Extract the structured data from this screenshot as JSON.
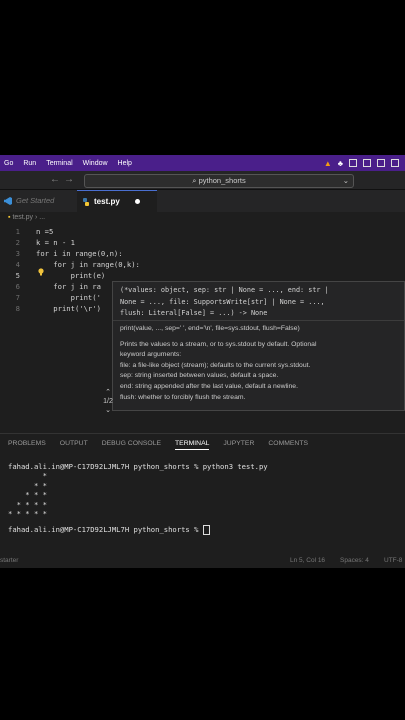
{
  "menubar": {
    "items": [
      "Go",
      "Run",
      "Terminal",
      "Window",
      "Help"
    ]
  },
  "search": {
    "text": "python_shorts"
  },
  "tabs": {
    "get_started": "Get Started",
    "active": "test.py"
  },
  "breadcrumb": {
    "file": "test.py",
    "more": "..."
  },
  "editor": {
    "line_numbers": [
      "1",
      "2",
      "3",
      "4",
      "5",
      "6",
      "7",
      "8"
    ],
    "lines": [
      "n =5",
      "k = n - 1",
      "for i in range(0,n):",
      "    for j in range(0,k):",
      "        print(e)",
      "    for j in ra",
      "        print('",
      "    print('\\r')"
    ]
  },
  "hover": {
    "signature": [
      "(*values: object, sep: str | None = ..., end: str |",
      "None = ..., file: SupportsWrite[str] | None = ...,",
      "flush: Literal[False] = ...) -> None"
    ],
    "usage": "print(value, ..., sep=' ', end='\\n', file=sys.stdout, flush=False)",
    "lines": [
      "Prints the values to a stream, or to sys.stdout by default. Optional",
      "keyword arguments:",
      "file: a file-like object (stream); defaults to the current sys.stdout.",
      "sep: string inserted between values, default a space.",
      "end: string appended after the last value, default a newline.",
      "flush: whether to forcibly flush the stream."
    ],
    "pager": "1/2"
  },
  "panel": {
    "tabs": [
      "PROBLEMS",
      "OUTPUT",
      "DEBUG CONSOLE",
      "TERMINAL",
      "JUPYTER",
      "COMMENTS"
    ],
    "active": "TERMINAL"
  },
  "terminal": {
    "lines": [
      "fahad.ali.in@MP-C17D92LJML7H python_shorts % python3 test.py",
      "        *",
      "      * *",
      "    * * *",
      "  * * * *",
      "* * * * *",
      "fahad.ali.in@MP-C17D92LJML7H python_shorts % "
    ]
  },
  "status": {
    "left": "starter",
    "position": "Ln 5, Col 16",
    "spaces": "Spaces: 4",
    "encoding": "UTF-8"
  }
}
